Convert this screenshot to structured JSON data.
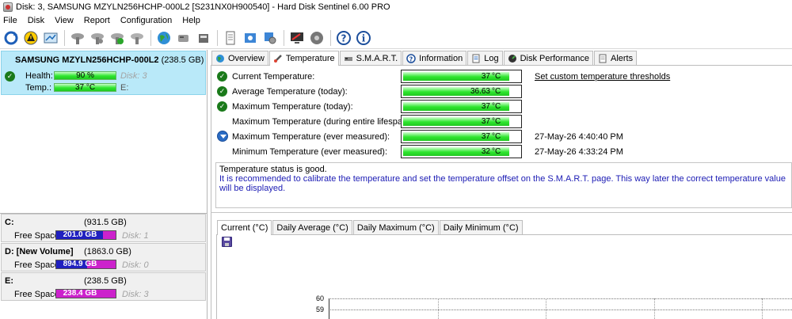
{
  "window": {
    "title": "Disk: 3, SAMSUNG MZYLN256HCHP-000L2 [S231NX0H900540]  -  Hard Disk Sentinel 6.00 PRO"
  },
  "menu": [
    "File",
    "Disk",
    "View",
    "Report",
    "Configuration",
    "Help"
  ],
  "toolbar": {
    "icons": [
      "refresh-icon",
      "warning-icon",
      "disk-report-icon",
      "disk-gray-icon",
      "disk-gray-2-icon",
      "disk-gray-3-icon",
      "disk-check-icon",
      "globe-icon",
      "disk-network-icon",
      "disk-send-icon",
      "report-icon",
      "tools-icon",
      "settings-icon",
      "monitor-icon",
      "disk-alert-icon",
      "help-icon",
      "info-icon"
    ]
  },
  "disk": {
    "name": "SAMSUNG MZYLN256HCHP-000L2",
    "size": "(238.5 GB)",
    "health_label": "Health:",
    "health_value": "90 %",
    "health_level": 90,
    "health_disk": "Disk: 3",
    "temp_label": "Temp.:",
    "temp_value": "37 °C",
    "temp_drive": "E:"
  },
  "volumes": [
    {
      "name": "C:",
      "size": "(931.5 GB)",
      "free_label": "Free Space",
      "free_value": "201.0 GB",
      "used_fraction": 0.78,
      "color": "#cc22cc",
      "disk": "Disk: 1"
    },
    {
      "name": "D: [New Volume]",
      "size": "(1863.0 GB)",
      "free_label": "Free Space",
      "free_value": "894.9 GB",
      "used_fraction": 0.52,
      "color": "#cc22cc",
      "disk": "Disk: 0"
    },
    {
      "name": "E:",
      "size": "(238.5 GB)",
      "free_label": "Free Space",
      "free_value": "238.4 GB",
      "used_fraction": 0.0,
      "color": "#cc22cc",
      "disk": "Disk: 3"
    }
  ],
  "tabs": [
    {
      "label": "Overview",
      "icon": "globe-icon",
      "active": false
    },
    {
      "label": "Temperature",
      "icon": "thermometer-icon",
      "active": true
    },
    {
      "label": "S.M.A.R.T.",
      "icon": "smart-icon",
      "active": false
    },
    {
      "label": "Information",
      "icon": "information-icon",
      "active": false
    },
    {
      "label": "Log",
      "icon": "log-icon",
      "active": false
    },
    {
      "label": "Disk Performance",
      "icon": "performance-icon",
      "active": false
    },
    {
      "label": "Alerts",
      "icon": "alerts-icon",
      "active": false
    }
  ],
  "temperatures": [
    {
      "label": "Current Temperature:",
      "value": "37",
      "unit": "°C",
      "status": "ok",
      "extra": "Set custom temperature thresholds",
      "extra_type": "link"
    },
    {
      "label": "Average Temperature (today):",
      "value": "36.63",
      "unit": "°C",
      "status": "ok",
      "extra": "",
      "extra_type": "none"
    },
    {
      "label": "Maximum Temperature (today):",
      "value": "37",
      "unit": "°C",
      "status": "ok",
      "extra": "",
      "extra_type": "none"
    },
    {
      "label": "Maximum Temperature (during entire lifespan):",
      "value": "37",
      "unit": "°C",
      "status": "none",
      "extra": "",
      "extra_type": "none"
    },
    {
      "label": "Maximum Temperature (ever measured):",
      "value": "37",
      "unit": "°C",
      "status": "info",
      "extra": "27-May-26 4:40:40 PM",
      "extra_type": "date"
    },
    {
      "label": "Minimum Temperature (ever measured):",
      "value": "32",
      "unit": "°C",
      "status": "none",
      "extra": "27-May-26 4:33:24 PM",
      "extra_type": "date"
    }
  ],
  "status": {
    "line1": "Temperature status is good.",
    "line2": "It is recommended to calibrate the temperature and set the temperature offset on the S.M.A.R.T. page. This way later the correct temperature value will be displayed."
  },
  "chart_tabs": [
    {
      "label": "Current (°C)",
      "active": true
    },
    {
      "label": "Daily Average (°C)",
      "active": false
    },
    {
      "label": "Daily Maximum (°C)",
      "active": false
    },
    {
      "label": "Daily Minimum (°C)",
      "active": false
    }
  ],
  "chart_data": {
    "type": "line",
    "title": "",
    "xlabel": "",
    "ylabel": "",
    "y_ticks": [
      "60",
      "59"
    ],
    "series": []
  },
  "colors": {
    "selected_disk_bg": "#b9e9f9",
    "good_bar": "#2ee62e",
    "volume_used": "#2020c0",
    "volume_free": "#cc22cc",
    "status_blue": "#1b1bb4"
  }
}
